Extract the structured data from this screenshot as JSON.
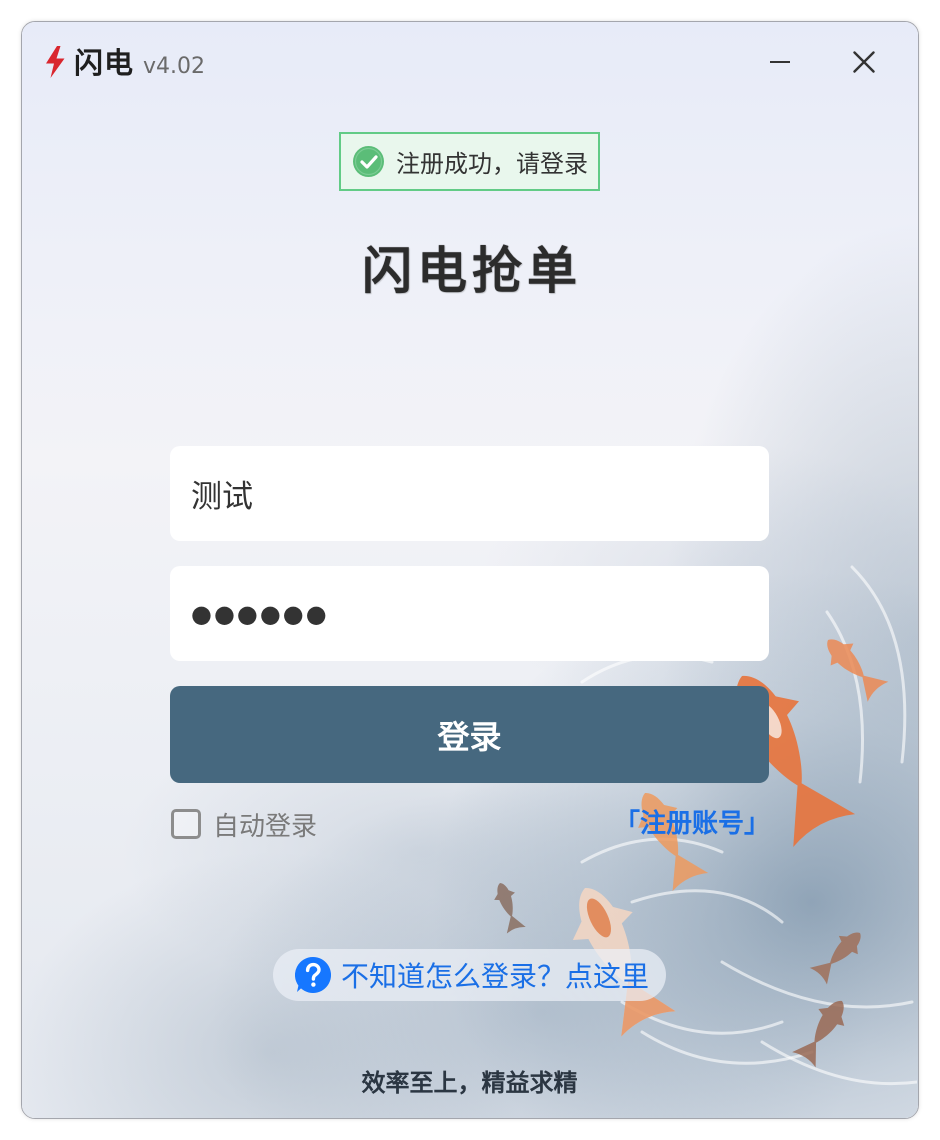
{
  "window": {
    "app_name": "闪电",
    "version": "v4.02",
    "icons": {
      "logo": "lightning-bolt-icon",
      "minimize": "minimize-icon",
      "close": "close-icon"
    }
  },
  "toast": {
    "message": "注册成功，请登录",
    "icon": "check-circle-icon"
  },
  "brand": {
    "title": "闪电抢单"
  },
  "login_form": {
    "username": {
      "value": "测试"
    },
    "password": {
      "value": "●●●●●●"
    },
    "submit_label": "登录",
    "auto_login": {
      "label": "自动登录",
      "checked": false
    },
    "register_link": "「注册账号」"
  },
  "help": {
    "icon": "question-circle-icon",
    "text": "不知道怎么登录？点这里"
  },
  "footer": {
    "slogan": "效率至上，精益求精"
  },
  "colors": {
    "logo_red": "#d9262e",
    "toast_border": "#62cb86",
    "toast_background": "#e9f7ed",
    "success_green": "#5bbd78",
    "primary_button": "#46687f",
    "link_blue": "#1a6fe6",
    "help_icon_blue": "#1677ff"
  }
}
